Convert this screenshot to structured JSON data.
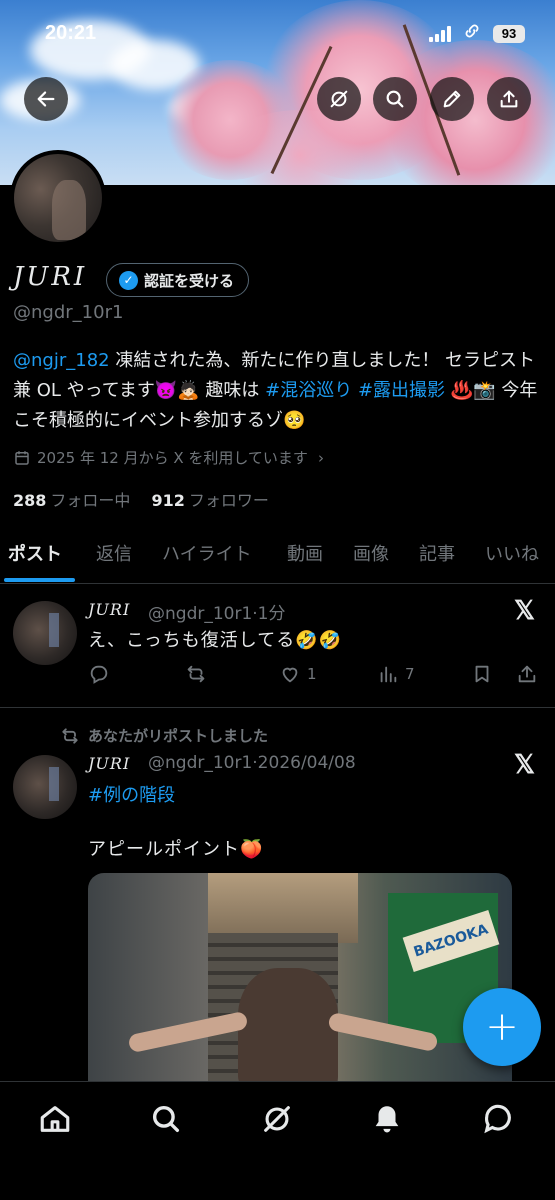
{
  "status_bar": {
    "time": "20:21",
    "battery": "93"
  },
  "profile": {
    "name": "JURI",
    "verify_button": "認証を受ける",
    "handle": "@ngdr_10r1",
    "bio": {
      "mention": "@ngjr_182",
      "text1": " 凍結された為、新たに作り直しました！ セラピスト兼 OL やってます",
      "emoji1": "👿🙇🏻",
      "text2": " 趣味は ",
      "tag1": "#混浴巡り",
      "tag2": "#露出撮影",
      "emoji2": " ♨️📸",
      "text3": " 今年こそ積極的にイベント参加するゾ",
      "emoji3": "🥺"
    },
    "joined": "2025 年 12 月から X を利用しています",
    "following_count": "288",
    "following_label": "フォロー中",
    "followers_count": "912",
    "followers_label": "フォロワー"
  },
  "tabs": [
    "ポスト",
    "返信",
    "ハイライト",
    "動画",
    "画像",
    "記事",
    "いいね"
  ],
  "posts": [
    {
      "name": "JURI",
      "meta": "@ngdr_10r1·1分",
      "text": "え、こっちも復活してる🤣🤣",
      "likes": "1",
      "views": "7"
    },
    {
      "repost_label": "あなたがリポストしました",
      "name": "JURI",
      "meta": "@ngdr_10r1·2026/04/08",
      "tag": "#例の階段",
      "text": "アピールポイント🍑",
      "media_sign": "BAZOOKA"
    }
  ],
  "fab_label": "+",
  "icons": {
    "back": "back-arrow-icon",
    "grok": "grok-icon",
    "search": "search-icon",
    "edit": "pencil-icon",
    "share": "share-icon",
    "x": "x-logo-icon"
  }
}
